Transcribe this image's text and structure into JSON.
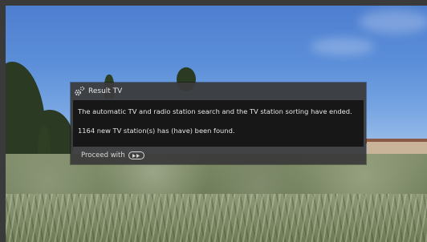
{
  "dialog": {
    "title": "Result TV",
    "message_1": "The automatic TV and radio station search and the TV station sorting have ended.",
    "message_2": "1164 new TV station(s) has (have) been found.",
    "proceed_label": "Proceed with",
    "icon": "gear-icon",
    "proceed_key_icon": "ok-key-icon"
  },
  "colors": {
    "dialog_bg": "#3a3a3a",
    "body_bg": "#171717",
    "text": "#e6e6e6"
  }
}
